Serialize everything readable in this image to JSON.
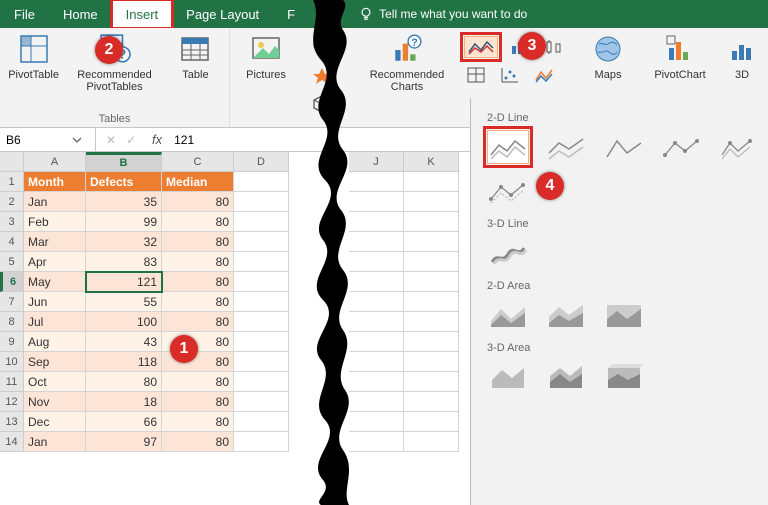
{
  "ribbon_tabs": {
    "file": "File",
    "home": "Home",
    "insert": "Insert",
    "page_layout": "Page Layout",
    "tell_me": "Tell me what you want to do"
  },
  "ribbon": {
    "pivottable": "PivotTable",
    "rec_pivot": "Recommended\nPivotTables",
    "table": "Table",
    "tables_grp": "Tables",
    "pictures": "Pictures",
    "rec_charts": "Recommended\nCharts",
    "maps": "Maps",
    "pivotchart": "PivotChart",
    "threeD": "3D"
  },
  "namebox": "B6",
  "fx_value": "121",
  "cols": {
    "A": "A",
    "B": "B",
    "C": "C",
    "D": "D",
    "J": "J",
    "K": "K"
  },
  "headers": {
    "month": "Month",
    "defects": "Defects",
    "median": "Median"
  },
  "rows": [
    {
      "n": "1"
    },
    {
      "n": "2",
      "m": "Jan",
      "d": "35",
      "md": "80"
    },
    {
      "n": "3",
      "m": "Feb",
      "d": "99",
      "md": "80"
    },
    {
      "n": "4",
      "m": "Mar",
      "d": "32",
      "md": "80"
    },
    {
      "n": "5",
      "m": "Apr",
      "d": "83",
      "md": "80"
    },
    {
      "n": "6",
      "m": "May",
      "d": "121",
      "md": "80"
    },
    {
      "n": "7",
      "m": "Jun",
      "d": "55",
      "md": "80"
    },
    {
      "n": "8",
      "m": "Jul",
      "d": "100",
      "md": "80"
    },
    {
      "n": "9",
      "m": "Aug",
      "d": "43",
      "md": "80"
    },
    {
      "n": "10",
      "m": "Sep",
      "d": "118",
      "md": "80"
    },
    {
      "n": "11",
      "m": "Oct",
      "d": "80",
      "md": "80"
    },
    {
      "n": "12",
      "m": "Nov",
      "d": "18",
      "md": "80"
    },
    {
      "n": "13",
      "m": "Dec",
      "d": "66",
      "md": "80"
    },
    {
      "n": "14",
      "m": "Jan",
      "d": "97",
      "md": "80"
    }
  ],
  "drop": {
    "s1": "2-D Line",
    "s2": "3-D Line",
    "s3": "2-D Area",
    "s4": "3-D Area"
  },
  "anno": {
    "1": "1",
    "2": "2",
    "3": "3",
    "4": "4"
  }
}
